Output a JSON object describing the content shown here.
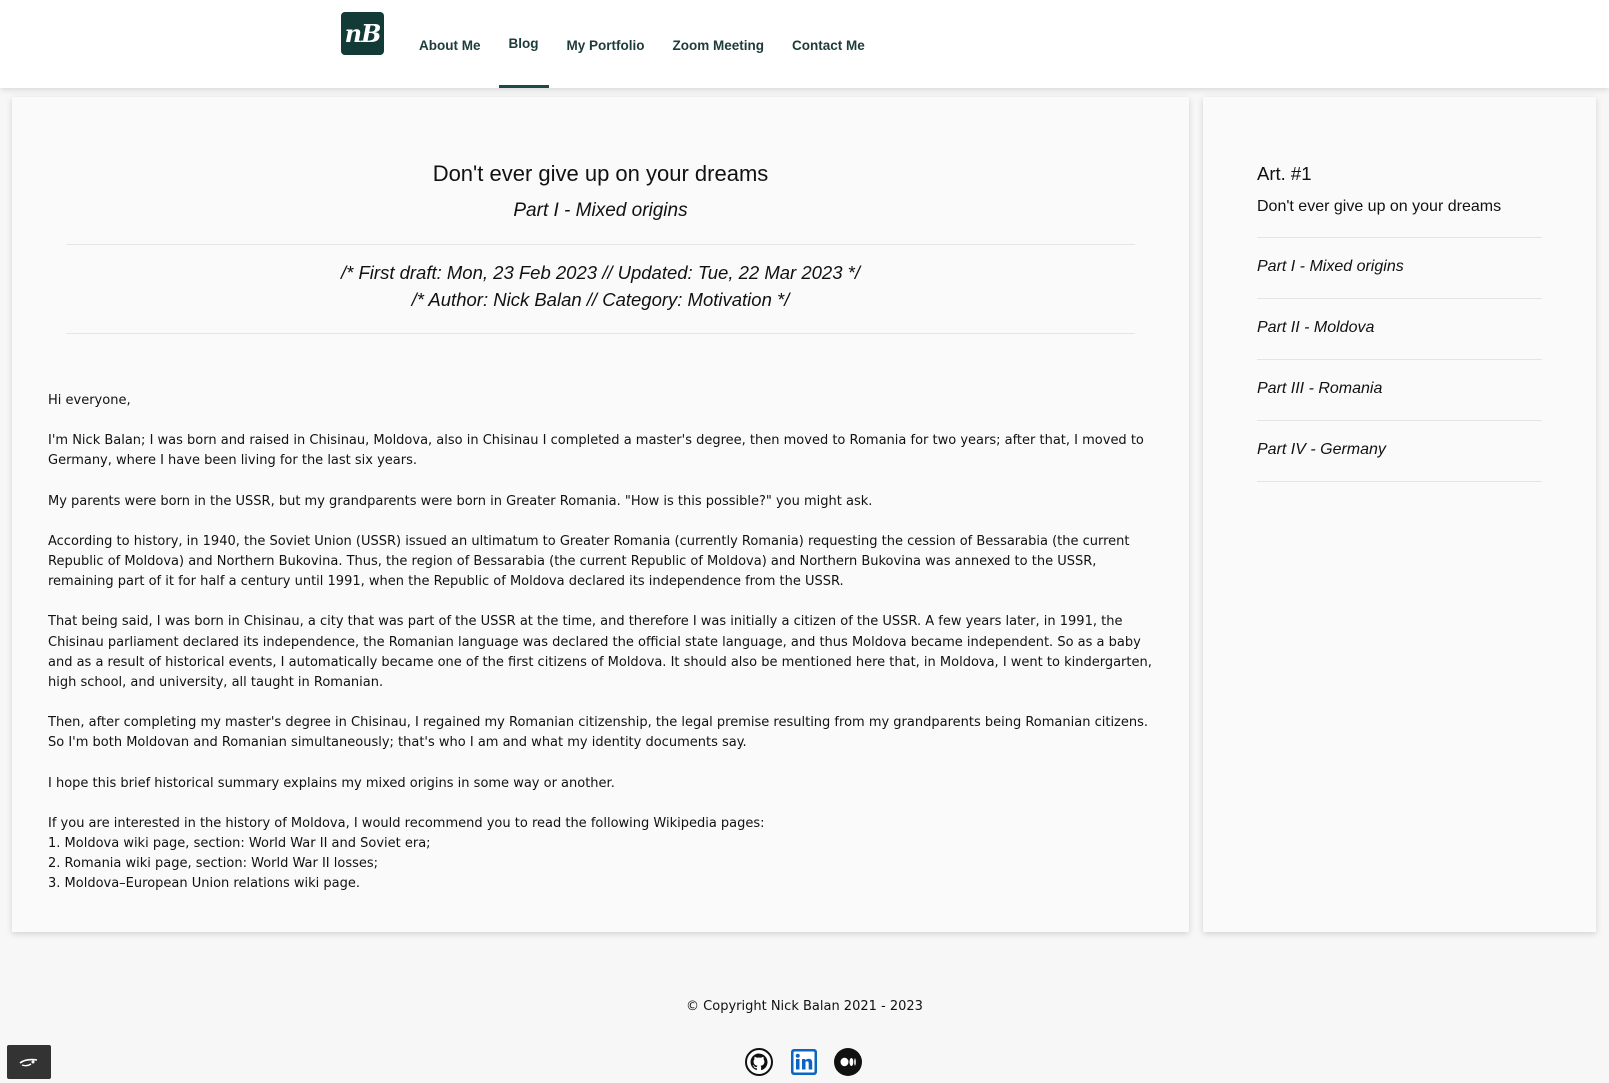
{
  "header": {
    "logo_text": "nB",
    "nav": [
      "About Me",
      "Blog",
      "My Portfolio",
      "Zoom Meeting",
      "Contact Me"
    ],
    "active_nav": "Blog"
  },
  "article": {
    "title": "Don't ever give up on your dreams",
    "subtitle": "Part I - Mixed origins",
    "meta_line1": "/* First draft: Mon, 23 Feb 2023 // Updated: Tue, 22 Mar 2023 */",
    "meta_line2": "/* Author: Nick Balan // Category: Motivation */",
    "paragraphs": [
      "Hi everyone,",
      "I'm Nick Balan; I was born and raised in Chisinau, Moldova, also in Chisinau I completed a master's degree, then moved to Romania for two years; after that, I moved to Germany, where I have been living for the last six years.",
      "My parents were born in the USSR, but my grandparents were born in Greater Romania. \"How is this possible?\" you might ask.",
      "According to history, in 1940, the Soviet Union (USSR) issued an ultimatum to Greater Romania (currently Romania) requesting the cession of Bessarabia (the current Republic of Moldova) and Northern Bukovina. Thus, the region of Bessarabia (the current Republic of Moldova) and Northern Bukovina was annexed to the USSR, remaining part of it for half a century until 1991, when the Republic of Moldova declared its independence from the USSR.",
      "That being said, I was born in Chisinau, a city that was part of the USSR at the time, and therefore I was initially a citizen of the USSR. A few years later, in 1991, the Chisinau parliament declared its independence, the Romanian language was declared the official state language, and thus Moldova became independent. So as a baby and as a result of historical events, I automatically became one of the first citizens of Moldova. It should also be mentioned here that, in Moldova, I went to kindergarten, high school, and university, all taught in Romanian.",
      "Then, after completing my master's degree in Chisinau, I regained my Romanian citizenship, the legal premise resulting from my grandparents being Romanian citizens. So I'm both Moldovan and Romanian simultaneously; that's who I am and what my identity documents say.",
      "I hope this brief historical summary explains my mixed origins in some way or another.",
      "If you are interested in the history of Moldova, I would recommend you to read the following Wikipedia pages:"
    ],
    "links": [
      "1. Moldova wiki page, section: World War II and Soviet era;",
      "2. Romania wiki page, section: World War II losses;",
      "3. Moldova–European Union relations wiki page."
    ]
  },
  "sidebar": {
    "label": "Art. #1",
    "title": "Don't ever give up on your dreams",
    "parts": [
      "Part I - Mixed origins",
      "Part II - Moldova",
      "Part III - Romania",
      "Part IV - Germany"
    ]
  },
  "footer": {
    "copyright": "© Copyright Nick Balan 2021 - 2023",
    "social_icons": [
      "github-icon",
      "linkedin-icon",
      "medium-icon"
    ],
    "linkedin_color": "#0a66c2",
    "corner_icon": "cookie-settings-icon"
  }
}
